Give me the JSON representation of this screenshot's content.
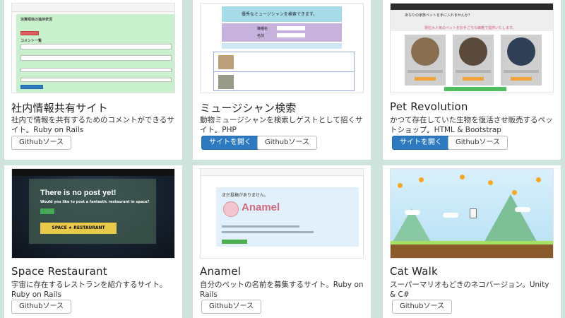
{
  "cards": [
    {
      "title": "社内情報共有サイト",
      "description": "社内で情報を共有するためのコメントができるサイト。Ruby on Rails",
      "buttons": {
        "github": "Githubソース"
      },
      "thumbnail": {
        "heading": "決算短信の進捗状況",
        "comment_label": "コメント一覧",
        "button": "コメントを投稿"
      }
    },
    {
      "title": "ミュージシャン検索",
      "description": "動物ミュージシャンを検索しゲストとして招くサイト。PHP",
      "buttons": {
        "open": "サイトを開く",
        "github": "Githubソース"
      },
      "thumbnail": {
        "heading": "優秀なミュージシャンを検索できます。",
        "field_1": "職種名",
        "field_2": "名前"
      }
    },
    {
      "title": "Pet Revolution",
      "description": "かつて存在していた生物を復活させ販売するペットショップ。HTML & Bootstrap",
      "buttons": {
        "open": "サイトを開く",
        "github": "Githubソース"
      },
      "thumbnail": {
        "heading": "あなたの家族ペットを手に入れませんか？",
        "subheading": "現在大人気のペットをお手ごろな価格で提供いたします。",
        "animals": [
          "ティラノサウルス",
          "サーベルタイガー",
          "シーラカンス"
        ],
        "button": "その他のペットを見る"
      }
    },
    {
      "title": "Space Restaurant",
      "description": "宇宙に存在するレストランを紹介するサイト。Ruby on Rails",
      "buttons": {
        "github": "Githubソース"
      },
      "thumbnail": {
        "headline": "There is no post yet!",
        "subline": "Would you like to post a fantastic restaurant in space?",
        "button": "New Post",
        "logo": "SPACE ★ RESTAURANT"
      }
    },
    {
      "title": "Anamel",
      "description": "自分のペットの名前を募集するサイト。Ruby on Rails",
      "buttons": {
        "github": "Githubソース"
      },
      "thumbnail": {
        "note": "まだ投稿がありません。",
        "logo": "Anamel"
      }
    },
    {
      "title": "Cat Walk",
      "description": "スーパーマリオもどきのネコバージョン。Unity & C#",
      "buttons": {
        "github": "Githubソース"
      },
      "thumbnail": {}
    }
  ],
  "colors": {
    "background": "#cfe3dd",
    "primary": "#2e7ac0"
  }
}
